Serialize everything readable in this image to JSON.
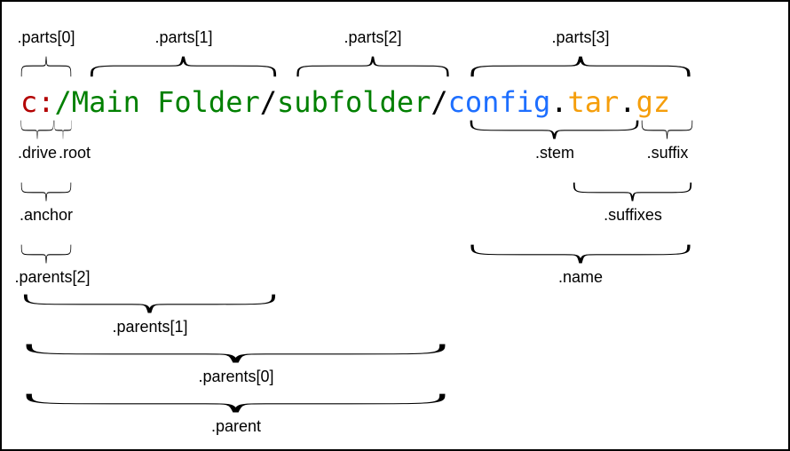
{
  "path": {
    "drive": "c:",
    "root": "/",
    "folders": [
      "Main Folder",
      "subfolder"
    ],
    "stem_base": "config",
    "suffixes_list": [
      ".tar",
      ".gz"
    ]
  },
  "colors": {
    "drive": "#b30000",
    "root": "#008000",
    "folder": "#008000",
    "sep": "#000000",
    "stem_base": "#1e6fff",
    "dot": "#000000",
    "suffix": "#f59e0b"
  },
  "labels": {
    "parts0": ".parts[0]",
    "parts1": ".parts[1]",
    "parts2": ".parts[2]",
    "parts3": ".parts[3]",
    "drive": ".drive",
    "root": ".root",
    "anchor": ".anchor",
    "parents2": ".parents[2]",
    "parents1": ".parents[1]",
    "parents0": ".parents[0]",
    "parent": ".parent",
    "stem": ".stem",
    "suffix": ".suffix",
    "suffixes": ".suffixes",
    "name": ".name"
  }
}
